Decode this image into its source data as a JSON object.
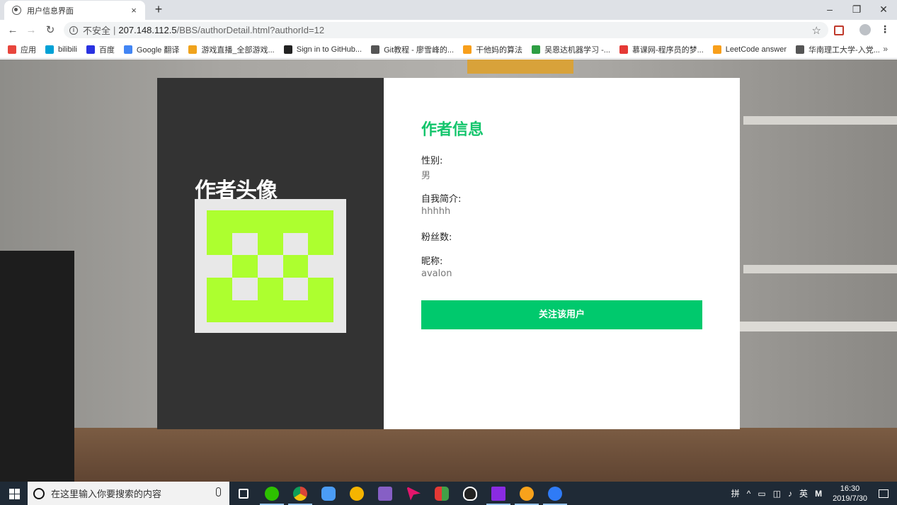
{
  "browser": {
    "tab_title": "用户信息界面",
    "tab_close": "×",
    "new_tab": "+",
    "window_controls": [
      "–",
      "❐",
      "✕"
    ],
    "address": {
      "security": "不安全",
      "separator": "|",
      "host": "207.148.112.5",
      "path": "/BBS/authorDetail.html?authorId=12"
    },
    "bookmarks": [
      {
        "label": "应用",
        "icon": "apps-grid-icon",
        "color": "#e8453c"
      },
      {
        "label": "bilibili",
        "icon": "bilibili-icon",
        "color": "#00a1d6"
      },
      {
        "label": "百度",
        "icon": "baidu-paw-icon",
        "color": "#2932e1"
      },
      {
        "label": "Google 翻译",
        "icon": "google-translate-icon",
        "color": "#4285f4"
      },
      {
        "label": "游戏直播_全部游戏...",
        "icon": "game-icon",
        "color": "#f0a31c"
      },
      {
        "label": "Sign in to GitHub...",
        "icon": "github-icon",
        "color": "#222222"
      },
      {
        "label": "Git教程 - 廖雪峰的...",
        "icon": "globe-icon",
        "color": "#555555"
      },
      {
        "label": "干他妈的算法",
        "icon": "leetcode-icon",
        "color": "#f89f1b"
      },
      {
        "label": "吴恩达机器学习 -...",
        "icon": "book-icon",
        "color": "#2e9e43"
      },
      {
        "label": "慕课网-程序员的梦...",
        "icon": "flame-icon",
        "color": "#e53935"
      },
      {
        "label": "LeetCode answer",
        "icon": "leetcode-icon",
        "color": "#f89f1b"
      },
      {
        "label": "华南理工大学-入党...",
        "icon": "globe-icon",
        "color": "#555555"
      }
    ],
    "more": "»"
  },
  "page": {
    "avatar_title": "作者头像",
    "info_title": "作者信息",
    "fields": [
      {
        "label": "性别:",
        "value": "男"
      },
      {
        "label": "自我简介:",
        "value": "hhhhh"
      },
      {
        "label": "粉丝数:",
        "value": ""
      },
      {
        "label": "昵称:",
        "value": "avalon"
      }
    ],
    "follow_button": "关注该用户",
    "colors": {
      "accent": "#14c56c",
      "button": "#00c96d",
      "left_panel": "#333333",
      "identicon": "#adff2f"
    }
  },
  "taskbar": {
    "search_placeholder": "在这里输入你要搜索的内容",
    "tray_text": [
      "拼",
      "^",
      "英"
    ],
    "time": "16:30",
    "date": "2019/7/30"
  }
}
